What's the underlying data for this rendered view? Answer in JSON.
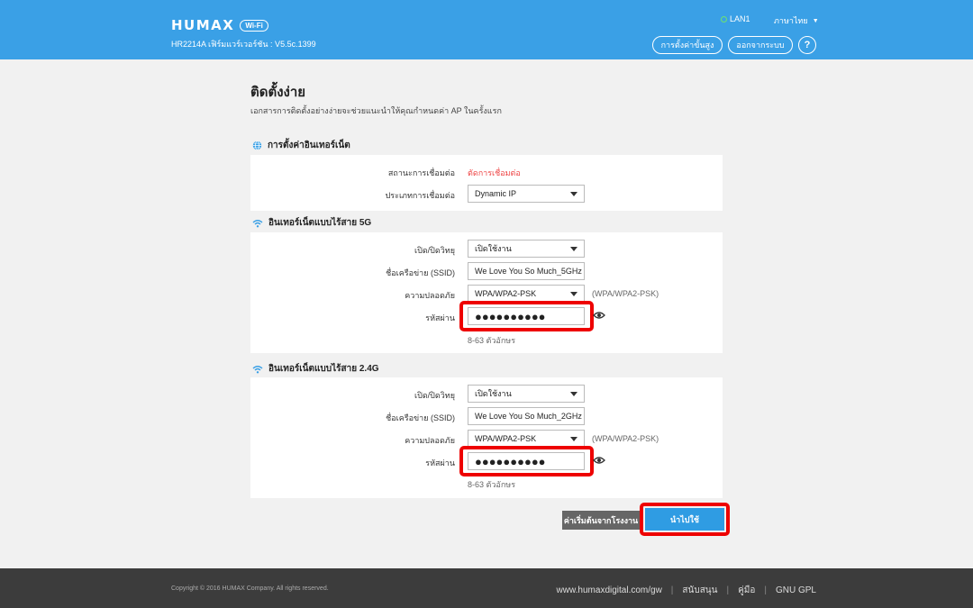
{
  "header": {
    "brand": "HUMAX",
    "brand_badge": "Wi-Fi",
    "model": "HR2214A เฟิร์มแวร์เวอร์ชัน : V5.5c.1399",
    "lan_label": "LAN1",
    "language": "ภาษาไทย",
    "advanced_btn": "การตั้งค่าขั้นสูง",
    "logout_btn": "ออกจากระบบ",
    "help_label": "?"
  },
  "page": {
    "title": "ติดตั้งง่าย",
    "description": "เอกสารการติดตั้งอย่างง่ายจะช่วยแนะนำให้คุณกำหนดค่า AP ในครั้งแรก"
  },
  "internet": {
    "heading": "การตั้งค่าอินเทอร์เน็ต",
    "status_label": "สถานะการเชื่อมต่อ",
    "status_value": "ตัดการเชื่อมต่อ",
    "type_label": "ประเภทการเชื่อมต่อ",
    "type_value": "Dynamic IP"
  },
  "wifi5g": {
    "heading": "อินเทอร์เน็ตแบบไร้สาย 5G",
    "radio_label": "เปิด/ปิดวิทยุ",
    "radio_value": "เปิดใช้งาน",
    "ssid_label": "ชื่อเครือข่าย (SSID)",
    "ssid_value": "We Love You So Much_5GHz",
    "security_label": "ความปลอดภัย",
    "security_value": "WPA/WPA2-PSK",
    "security_hint": "(WPA/WPA2-PSK)",
    "password_label": "รหัสผ่าน",
    "password_value": "●●●●●●●●●●",
    "password_hint": "8-63 ตัวอักษร"
  },
  "wifi24g": {
    "heading": "อินเทอร์เน็ตแบบไร้สาย 2.4G",
    "radio_label": "เปิด/ปิดวิทยุ",
    "radio_value": "เปิดใช้งาน",
    "ssid_label": "ชื่อเครือข่าย (SSID)",
    "ssid_value": "We Love You So Much_2GHz",
    "security_label": "ความปลอดภัย",
    "security_value": "WPA/WPA2-PSK",
    "security_hint": "(WPA/WPA2-PSK)",
    "password_label": "รหัสผ่าน",
    "password_value": "●●●●●●●●●●",
    "password_hint": "8-63 ตัวอักษร"
  },
  "actions": {
    "reset_label": "ค่าเริ่มต้นจากโรงงาน",
    "apply_label": "นำไปใช้"
  },
  "footer": {
    "copyright": "Copyright © 2016 HUMAX Company. All rights reserved.",
    "website": "www.humaxdigital.com/gw",
    "support": "สนับสนุน",
    "manual": "คู่มือ",
    "gpl": "GNU GPL"
  },
  "colors": {
    "header_bg": "#3aa0e6",
    "highlight": "#e00000",
    "status_red": "#e44444",
    "apply_bg": "#2f9ce3",
    "footer_bg": "#3c3c3c"
  }
}
